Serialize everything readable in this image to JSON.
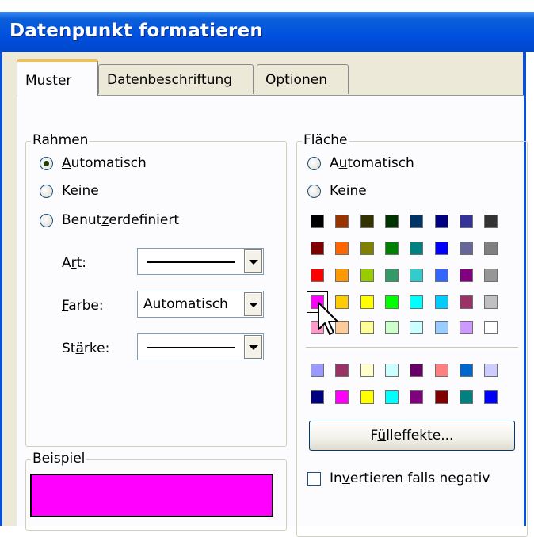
{
  "window": {
    "title": "Datenpunkt formatieren"
  },
  "tabs": [
    {
      "label": "Muster",
      "active": true
    },
    {
      "label": "Datenbeschriftung",
      "active": false
    },
    {
      "label": "Optionen",
      "active": false
    }
  ],
  "rahmen": {
    "legend": "Rahmen",
    "options": [
      {
        "pre": "",
        "key": "A",
        "post": "utomatisch",
        "checked": true
      },
      {
        "pre": "",
        "key": "K",
        "post": "eine",
        "checked": false
      },
      {
        "pre": "Benut",
        "key": "z",
        "post": "erdefiniert",
        "checked": false
      }
    ],
    "art": {
      "pre": "A",
      "key": "r",
      "post": "t:"
    },
    "farbe": {
      "pre": "",
      "key": "F",
      "post": "arbe:",
      "value": "Automatisch"
    },
    "staerke": {
      "pre": "St",
      "key": "ä",
      "post": "rke:"
    }
  },
  "beispiel": {
    "legend": "Beispiel",
    "color": "#ff00ff"
  },
  "flaeche": {
    "legend": "Fläche",
    "options": [
      {
        "pre": "A",
        "key": "u",
        "post": "tomatisch",
        "checked": false
      },
      {
        "pre": "Kei",
        "key": "n",
        "post": "e",
        "checked": false
      }
    ],
    "palette_top": [
      [
        "#000000",
        "#993300",
        "#333300",
        "#003300",
        "#003366",
        "#000080",
        "#333399",
        "#333333"
      ],
      [
        "#800000",
        "#ff6600",
        "#808000",
        "#008000",
        "#008080",
        "#0000ff",
        "#666699",
        "#808080"
      ],
      [
        "#ff0000",
        "#ff9900",
        "#99cc00",
        "#339966",
        "#33cccc",
        "#3366ff",
        "#800080",
        "#969696"
      ],
      [
        "#ff00ff",
        "#ffcc00",
        "#ffff00",
        "#00ff00",
        "#00ffff",
        "#00ccff",
        "#993366",
        "#c0c0c0"
      ],
      [
        "#ff99cc",
        "#ffcc99",
        "#ffff99",
        "#ccffcc",
        "#ccffff",
        "#99ccff",
        "#cc99ff",
        "#ffffff"
      ]
    ],
    "palette_bottom": [
      [
        "#9999ff",
        "#993366",
        "#ffffcc",
        "#ccffff",
        "#660066",
        "#ff8080",
        "#0066cc",
        "#ccccff"
      ],
      [
        "#000080",
        "#ff00ff",
        "#ffff00",
        "#00ffff",
        "#800080",
        "#800000",
        "#008080",
        "#0000ff"
      ]
    ],
    "selected_color": "#ff00ff",
    "fill_effects_button": {
      "pre": "F",
      "key": "ü",
      "post": "lleffekte..."
    },
    "invert": {
      "pre": "In",
      "key": "v",
      "post": "ertieren falls negativ",
      "checked": false
    }
  }
}
